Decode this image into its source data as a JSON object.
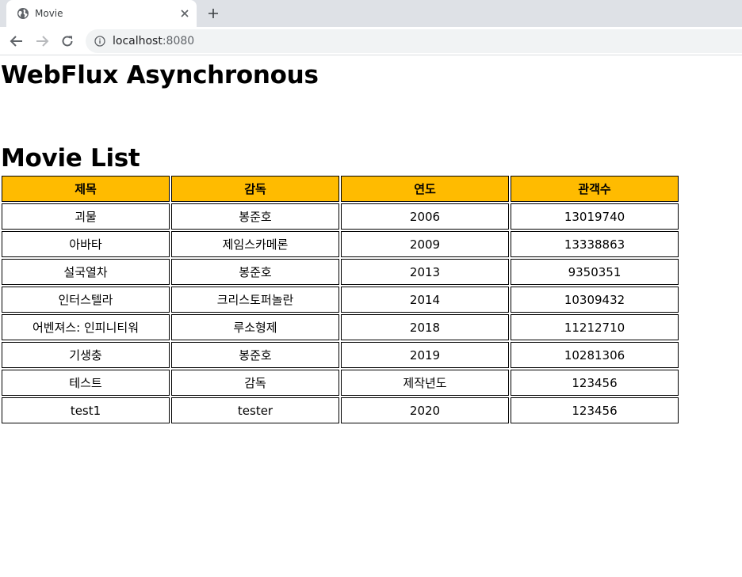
{
  "browser": {
    "tab_title": "Movie",
    "url_host": "localhost",
    "url_port": ":8080"
  },
  "page": {
    "heading": "WebFlux Asynchronous",
    "list_heading": "Movie List"
  },
  "table": {
    "headers": [
      "제목",
      "감독",
      "연도",
      "관객수"
    ],
    "header_color": "#ffbb00",
    "rows": [
      [
        "괴물",
        "봉준호",
        "2006",
        "13019740"
      ],
      [
        "아바타",
        "제임스카메론",
        "2009",
        "13338863"
      ],
      [
        "설국열차",
        "봉준호",
        "2013",
        "9350351"
      ],
      [
        "인터스텔라",
        "크리스토퍼놀란",
        "2014",
        "10309432"
      ],
      [
        "어벤져스: 인피니티워",
        "루소형제",
        "2018",
        "11212710"
      ],
      [
        "기생충",
        "봉준호",
        "2019",
        "10281306"
      ],
      [
        "테스트",
        "감독",
        "제작년도",
        "123456"
      ],
      [
        "test1",
        "tester",
        "2020",
        "123456"
      ]
    ]
  }
}
